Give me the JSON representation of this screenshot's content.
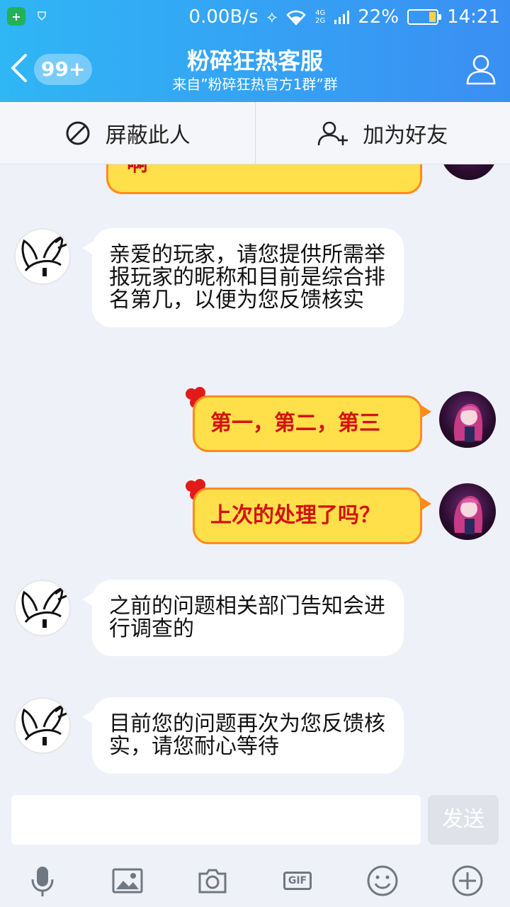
{
  "status_bar": {
    "net_speed": "0.00B/s",
    "battery_percent": "22%",
    "time": "14:21",
    "signal_labels": [
      "4G",
      "2G"
    ]
  },
  "header": {
    "back_icon": "chevron-left-icon",
    "unread_badge": "99+",
    "title": "粉碎狂热客服",
    "subtitle": "来自”粉碎狂热官方1群”群",
    "profile_icon": "person-icon"
  },
  "actions": {
    "block": {
      "label": "屏蔽此人",
      "icon": "block-icon"
    },
    "add_friend": {
      "label": "加为好友",
      "icon": "add-user-icon"
    }
  },
  "messages": [
    {
      "side": "right",
      "text": "啊",
      "clipped": true
    },
    {
      "side": "left",
      "text": "亲爱的玩家，请您提供所需举报玩家的昵称和目前是综合排名第几，以便为您反馈核实"
    },
    {
      "side": "right",
      "text": "第一，第二，第三"
    },
    {
      "side": "right",
      "text": "上次的处理了吗？"
    },
    {
      "side": "left",
      "text": "之前的问题相关部门告知会进行调查的"
    },
    {
      "side": "left",
      "text": "目前您的问题再次为您反馈核实，请您耐心等待"
    }
  ],
  "input": {
    "placeholder": "",
    "send_label": "发送"
  },
  "toolbar": {
    "icons": [
      "microphone-icon",
      "image-icon",
      "camera-icon",
      "gif-icon",
      "emoji-icon",
      "plus-icon"
    ],
    "gif_label": "GIF"
  },
  "colors": {
    "header_start": "#2fb6f5",
    "header_end": "#3a8ff3",
    "bubble_mine_fill": "#ffe04a",
    "bubble_mine_border": "#ff8a1c",
    "bubble_mine_text": "#d3120f"
  }
}
